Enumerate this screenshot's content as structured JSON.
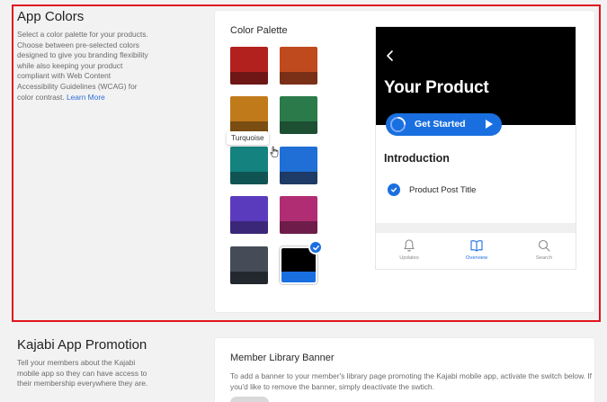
{
  "app_colors": {
    "title": "App Colors",
    "description": "Select a color palette for your products. Choose between pre-selected colors designed to give you branding flexibility while also keeping your product compliant with Web Content Accessibility Guidelines (WCAG) for color contrast.",
    "learn_more": "Learn More",
    "palette_label": "Color Palette",
    "tooltip": "Turquoise",
    "swatches": [
      {
        "name": "red",
        "top": "#b3211f",
        "bottom": "#6e1716"
      },
      {
        "name": "orange",
        "top": "#bf4a1e",
        "bottom": "#7a2f17"
      },
      {
        "name": "amber",
        "top": "#c17a1a",
        "bottom": "#7a4d12"
      },
      {
        "name": "green",
        "top": "#2a7a4a",
        "bottom": "#1d4f33"
      },
      {
        "name": "turquoise",
        "top": "#14827e",
        "bottom": "#0f5453"
      },
      {
        "name": "blue",
        "top": "#1f6fd6",
        "bottom": "#1e3a66"
      },
      {
        "name": "purple",
        "top": "#5b3bbd",
        "bottom": "#3a2778"
      },
      {
        "name": "magenta",
        "top": "#b02d74",
        "bottom": "#6e1d4a"
      },
      {
        "name": "slate",
        "top": "#454c57",
        "bottom": "#23282f"
      },
      {
        "name": "black",
        "top": "#000000",
        "bottom": "#1a6fe0",
        "selected": true
      }
    ],
    "preview": {
      "product_title": "Your Product",
      "cta_label": "Get Started",
      "section_title": "Introduction",
      "post_title": "Product Post Title",
      "tabs": [
        {
          "label": "Updates",
          "icon": "bell-icon"
        },
        {
          "label": "Overview",
          "icon": "book-icon",
          "active": true
        },
        {
          "label": "Search",
          "icon": "search-icon"
        }
      ]
    }
  },
  "app_promotion": {
    "title": "Kajabi App Promotion",
    "description": "Tell your members about the Kajabi mobile app so they can have access to their membership everywhere they are.",
    "banner_title": "Member Library Banner",
    "banner_description": "To add a banner to your member's library page promoting the Kajabi mobile app, activate the switch below. If you'd like to remove the banner, simply deactivate the swtich."
  },
  "colors": {
    "accent": "#1a6fe0",
    "highlight_border": "#e0141e"
  }
}
